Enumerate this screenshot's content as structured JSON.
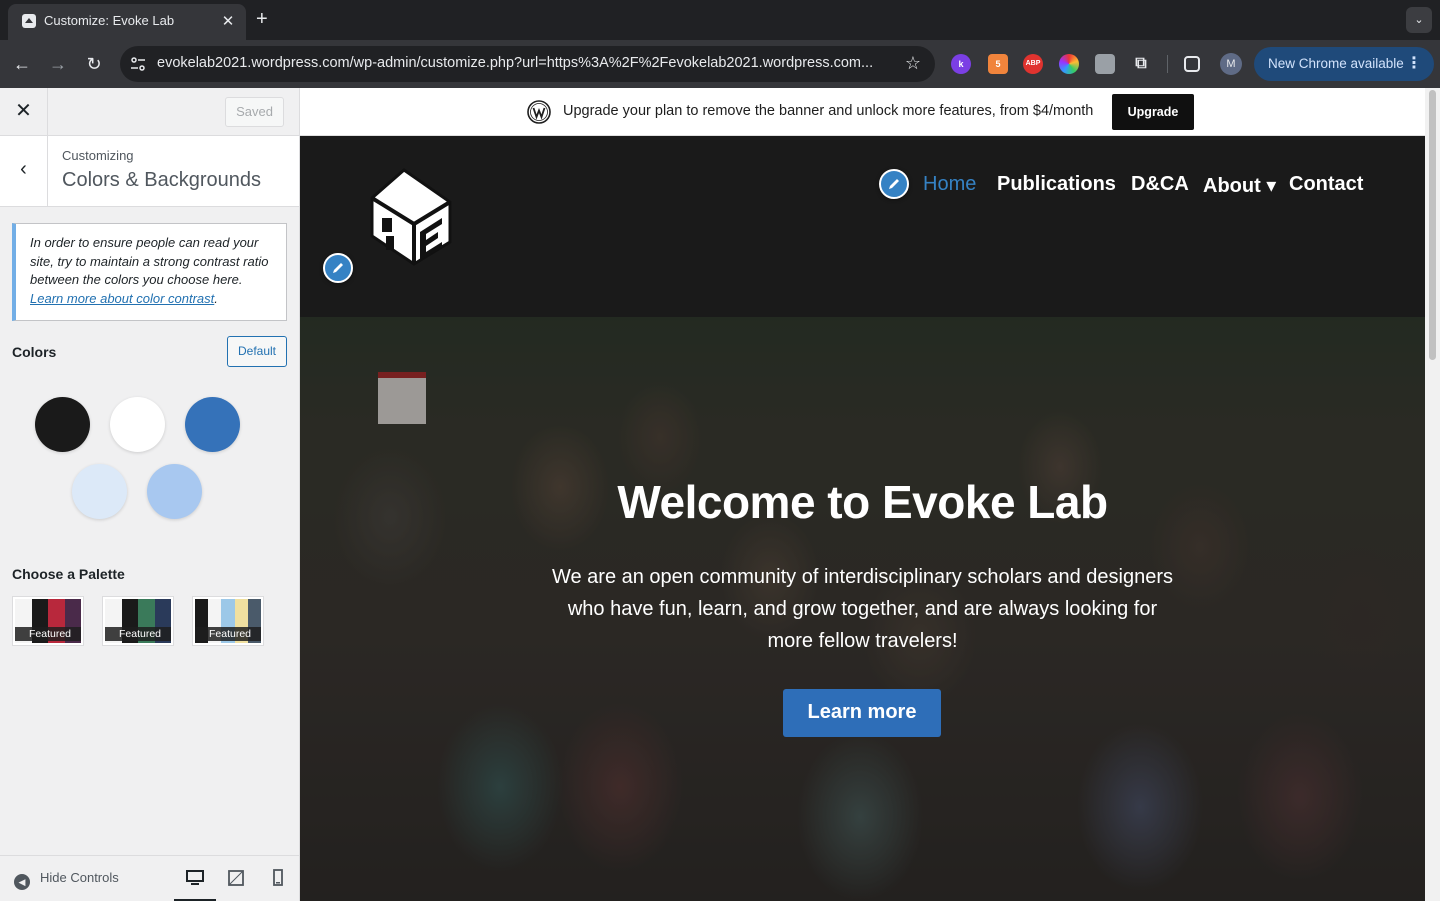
{
  "browser": {
    "tab_title": "Customize: Evoke Lab",
    "tab_close": "✕",
    "new_tab": "+",
    "tab_search": "⌄",
    "url": "evokelab2021.wordpress.com/wp-admin/customize.php?url=https%3A%2F%2Fevokelab2021.wordpress.com...",
    "update_label": "New Chrome available",
    "avatar_letter": "M",
    "extensions": [
      {
        "name": "k",
        "color": "#7b3fe4"
      },
      {
        "name": "5",
        "color": "#f0843c"
      },
      {
        "name": "ABP",
        "color": "#e0332f"
      },
      {
        "name": "",
        "color": "#3c9"
      },
      {
        "name": "",
        "color": "#9aa0a6"
      }
    ]
  },
  "sidebar": {
    "close": "✕",
    "saved_label": "Saved",
    "back": "‹",
    "breadcrumb_small": "Customizing",
    "breadcrumb_title": "Colors & Backgrounds",
    "notice_text": "In order to ensure people can read your site, try to maintain a strong contrast ratio between the colors you choose here. ",
    "notice_link": "Learn more about color contrast",
    "notice_end": ".",
    "colors_label": "Colors",
    "default_label": "Default",
    "swatches": [
      "#1a1a1a",
      "#ffffff",
      "#3572b9",
      "#dce9f8",
      "#a8c8f0"
    ],
    "palette_label": "Choose a Palette",
    "palettes": [
      {
        "tag": "Featured",
        "colors": [
          "#f4f4f4",
          "#1a1a1a",
          "#b8283c",
          "#4a2a4a"
        ]
      },
      {
        "tag": "Featured",
        "colors": [
          "#f4f4f4",
          "#1a1a1a",
          "#3a7a5a",
          "#2a3a5a"
        ]
      },
      {
        "tag": "Featured",
        "colors": [
          "#1a1a1a",
          "#f4f4f4",
          "#9cc8e8",
          "#f0e0a0",
          "#4a5a6a"
        ]
      }
    ],
    "hide_controls": "Hide Controls"
  },
  "preview": {
    "banner_text": "Upgrade your plan to remove the banner and unlock more features, from $4/month",
    "upgrade_label": "Upgrade",
    "menu": [
      "Home",
      "Publications",
      "D&CA",
      "About ▾",
      "Contact"
    ],
    "hero_title": "Welcome to Evoke Lab",
    "hero_text": "We are an open community of interdisciplinary scholars and designers who have fun, learn, and grow together, and are always looking for more fellow travelers!",
    "hero_button": "Learn more",
    "accent_color": "#3582c4"
  }
}
